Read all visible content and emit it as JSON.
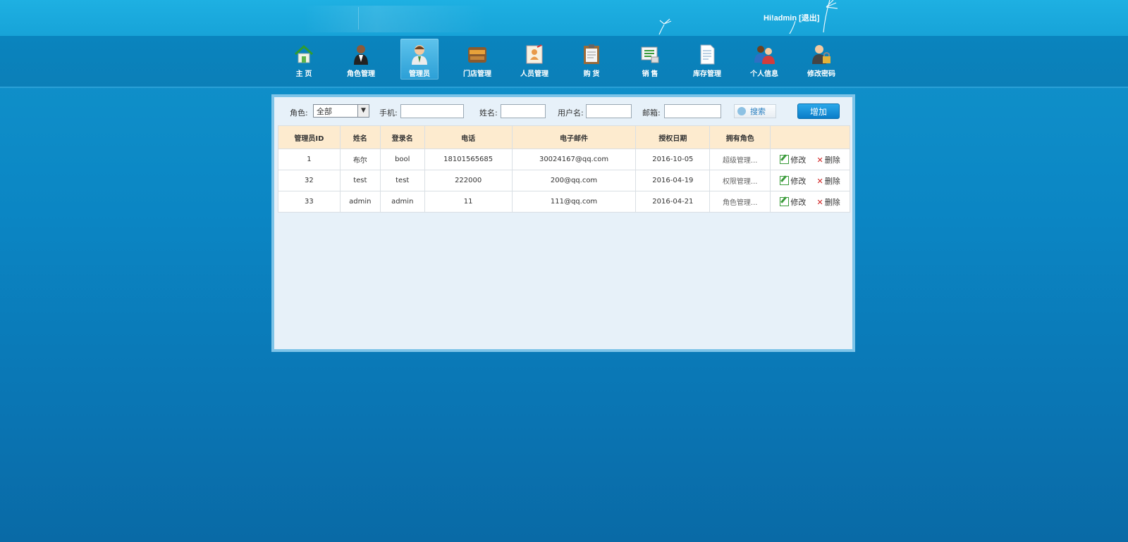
{
  "header": {
    "greeting": "Hi!admin",
    "logout_label": "[退出]"
  },
  "nav": {
    "items": [
      {
        "label": "主  页",
        "icon": "home-icon"
      },
      {
        "label": "角色管理",
        "icon": "waiter-icon"
      },
      {
        "label": "管理员",
        "icon": "admin-user-icon",
        "active": true
      },
      {
        "label": "门店管理",
        "icon": "store-sign-icon"
      },
      {
        "label": "人员管理",
        "icon": "staff-card-icon"
      },
      {
        "label": "购  货",
        "icon": "clipboard-icon"
      },
      {
        "label": "销  售",
        "icon": "sales-icon"
      },
      {
        "label": "库存管理",
        "icon": "document-icon"
      },
      {
        "label": "个人信息",
        "icon": "people-icon"
      },
      {
        "label": "修改密码",
        "icon": "user-lock-icon"
      }
    ]
  },
  "filters": {
    "role_label": "角色:",
    "role_value": "全部",
    "phone_label": "手机:",
    "phone_value": "",
    "name_label": "姓名:",
    "name_value": "",
    "username_label": "用户名:",
    "username_value": "",
    "email_label": "邮箱:",
    "email_value": "",
    "search_label": "搜索",
    "add_label": "增加"
  },
  "table": {
    "headers": [
      "管理员ID",
      "姓名",
      "登录名",
      "电话",
      "电子邮件",
      "授权日期",
      "拥有角色",
      ""
    ],
    "rows": [
      {
        "id": "1",
        "name": "布尔",
        "login": "bool",
        "phone": "18101565685",
        "email": "30024167@qq.com",
        "date": "2016-10-05",
        "role": "超级管理...",
        "edit": "修改",
        "delete": "删除"
      },
      {
        "id": "32",
        "name": "test",
        "login": "test",
        "phone": "222000",
        "email": "200@qq.com",
        "date": "2016-04-19",
        "role": "权限管理...",
        "edit": "修改",
        "delete": "删除"
      },
      {
        "id": "33",
        "name": "admin",
        "login": "admin",
        "phone": "11",
        "email": "111@qq.com",
        "date": "2016-04-21",
        "role": "角色管理...",
        "edit": "修改",
        "delete": "删除"
      }
    ]
  },
  "colors": {
    "accent": "#0b86c4",
    "header_row": "#fdebcf",
    "panel_bg": "#e7f1f9"
  }
}
